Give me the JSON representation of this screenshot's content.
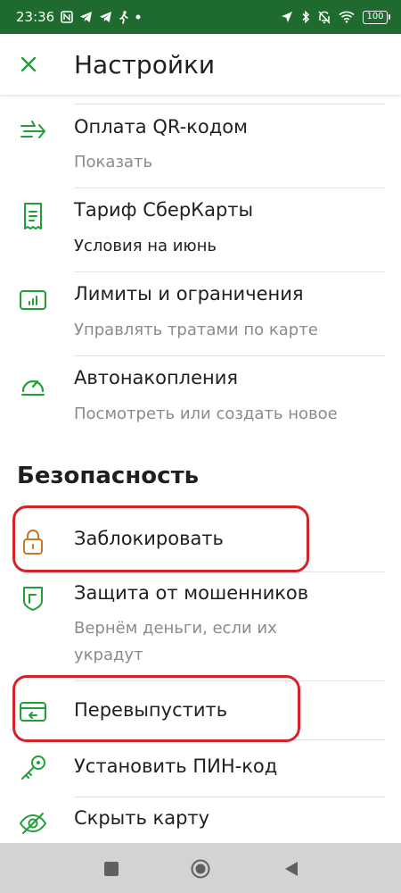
{
  "status_bar": {
    "time": "23:36",
    "battery": "100"
  },
  "header": {
    "title": "Настройки",
    "close_icon": "close-icon"
  },
  "items_top": [
    {
      "title": "Оплата QR-кодом",
      "subtitle": "Показать",
      "icon": "qr-pay-icon"
    },
    {
      "title": "Тариф СберКарты",
      "subtitle": "Условия на июнь",
      "icon": "tariff-document-icon"
    },
    {
      "title": "Лимиты и ограничения",
      "subtitle": "Управлять тратами по карте",
      "icon": "limits-chart-icon"
    },
    {
      "title": "Автонакопления",
      "subtitle": "Посмотреть или создать новое",
      "icon": "gauge-icon"
    }
  ],
  "security": {
    "section_title": "Безопасность",
    "items": [
      {
        "title": "Заблокировать",
        "icon": "lock-icon"
      },
      {
        "title": "Защита от мошенников",
        "subtitle_line1": "Вернём деньги, если их",
        "subtitle_line2": "украдут",
        "icon": "shield-icon"
      },
      {
        "title": "Перевыпустить",
        "icon": "reissue-card-icon"
      },
      {
        "title": "Установить ПИН-код",
        "icon": "key-icon"
      },
      {
        "title": "Скрыть карту",
        "icon": "eye-hidden-icon"
      }
    ]
  },
  "colors": {
    "status_bar": "#1f6b2f",
    "accent_green": "#21a038",
    "lock_orange": "#c8782a",
    "highlight_red": "#d2232a"
  },
  "nav_bar": {
    "icons": [
      "recent-apps-icon",
      "home-icon",
      "back-icon"
    ]
  }
}
